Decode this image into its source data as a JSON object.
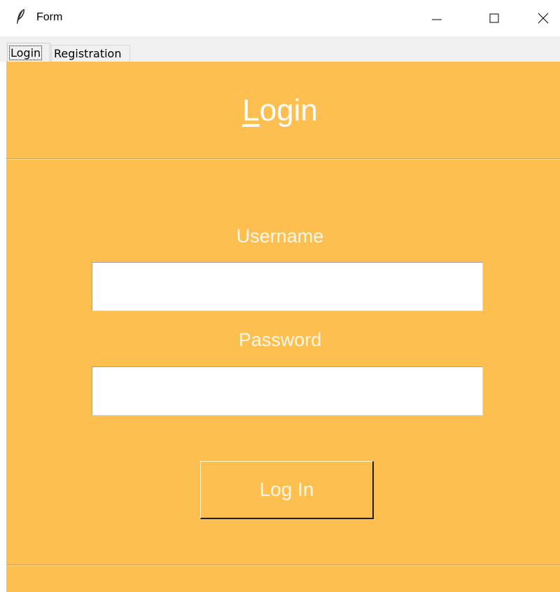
{
  "window": {
    "title": "Form",
    "icon": "feather-icon",
    "controls": [
      "minimize",
      "maximize",
      "close"
    ]
  },
  "tabs": [
    {
      "label": "Login",
      "selected": true
    },
    {
      "label": "Registration",
      "selected": false
    }
  ],
  "login": {
    "heading_first_letter": "L",
    "heading_rest": "ogin",
    "username_label": "Username",
    "username_value": "",
    "password_label": "Password",
    "password_value": "",
    "submit_label": "Log In"
  },
  "colors": {
    "panel": "#fdbf4f",
    "text_light": "#ffffff"
  }
}
